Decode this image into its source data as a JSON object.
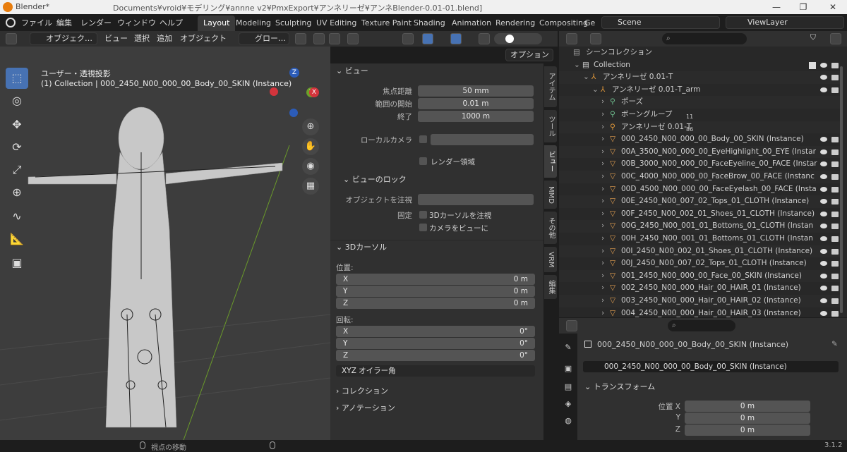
{
  "titlebar": {
    "app": "Blender*",
    "path": "Documents¥vroid¥モデリング¥annne v2¥PmxExport¥アンネリーゼ¥アンネBlender-0.01-01.blend]",
    "minimize": "—",
    "restore": "❐",
    "close": "✕"
  },
  "menu": [
    "ファイル",
    "編集",
    "レンダー",
    "ウィンドウ",
    "ヘルプ"
  ],
  "workspaces": [
    "Layout",
    "Modeling",
    "Sculpting",
    "UV Editing",
    "Texture Paint",
    "Shading",
    "Animation",
    "Rendering",
    "Compositing",
    "Ge"
  ],
  "scene": {
    "label": "Scene",
    "viewlayer": "ViewLayer"
  },
  "viewport_header": {
    "mode": "オブジェク…",
    "view": "ビュー",
    "select": "選択",
    "add": "追加",
    "object": "オブジェクト",
    "orientation": "グロー…",
    "options": "オプション"
  },
  "viewport": {
    "perspective": "ユーザー・透視投影",
    "context": "(1) Collection | 000_2450_N00_000_00_Body_00_SKIN (Instance)",
    "gizmo": {
      "z": "Z",
      "y": "Y",
      "x": "X"
    }
  },
  "npanel": {
    "view_section": "ビュー",
    "focal_label": "焦点距離",
    "focal": "50 mm",
    "clip_start_label": "範囲の開始",
    "clip_start": "0.01 m",
    "clip_end_label": "終了",
    "clip_end": "1000 m",
    "local_camera_label": "ローカルカメラ",
    "render_region": "レンダー領域",
    "view_lock_section": "ビューのロック",
    "lock_object_label": "オブジェクトを注視",
    "lock_label": "固定",
    "lock_cursor": "3Dカーソルを注視",
    "camera_to_view": "カメラをビューに",
    "cursor_section": "3Dカーソル",
    "location_label": "位置:",
    "loc": [
      {
        "axis": "X",
        "value": "0 m"
      },
      {
        "axis": "Y",
        "value": "0 m"
      },
      {
        "axis": "Z",
        "value": "0 m"
      }
    ],
    "rotation_label": "回転:",
    "rot": [
      {
        "axis": "X",
        "value": "0°"
      },
      {
        "axis": "Y",
        "value": "0°"
      },
      {
        "axis": "Z",
        "value": "0°"
      }
    ],
    "rotation_mode": "XYZ オイラー角",
    "collection_section": "コレクション",
    "annotation_section": "アノテーション"
  },
  "ntabs": [
    "アイテム",
    "ツール",
    "ビュー",
    "MMD",
    "その他",
    "VRM",
    "編集"
  ],
  "outliner": {
    "scene_collection": "シーンコレクション",
    "rows": [
      {
        "name": "Collection",
        "indent": 1
      },
      {
        "name": "アンネリーゼ 0.01-T",
        "indent": 2
      },
      {
        "name": "アンネリーゼ 0.01-T_arm",
        "indent": 3
      },
      {
        "name": "ポーズ",
        "indent": 4
      },
      {
        "name": "ボーングループ",
        "indent": 4,
        "badge": "11"
      },
      {
        "name": "アンネリーゼ 0.01-T",
        "indent": 4,
        "badge": "86"
      },
      {
        "name": "000_2450_N00_000_00_Body_00_SKIN (Instance)",
        "indent": 4
      },
      {
        "name": "00A_3500_N00_000_00_EyeHighlight_00_EYE (Instar",
        "indent": 4
      },
      {
        "name": "00B_3000_N00_000_00_FaceEyeline_00_FACE (Instar",
        "indent": 4
      },
      {
        "name": "00C_4000_N00_000_00_FaceBrow_00_FACE (Instanc",
        "indent": 4
      },
      {
        "name": "00D_4500_N00_000_00_FaceEyelash_00_FACE (Insta",
        "indent": 4
      },
      {
        "name": "00E_2450_N00_007_02_Tops_01_CLOTH (Instance)",
        "indent": 4
      },
      {
        "name": "00F_2450_N00_002_01_Shoes_01_CLOTH (Instance)",
        "indent": 4
      },
      {
        "name": "00G_2450_N00_001_01_Bottoms_01_CLOTH (Instan",
        "indent": 4
      },
      {
        "name": "00H_2450_N00_001_01_Bottoms_01_CLOTH (Instan",
        "indent": 4
      },
      {
        "name": "00I_2450_N00_002_01_Shoes_01_CLOTH (Instance)",
        "indent": 4
      },
      {
        "name": "00J_2450_N00_007_02_Tops_01_CLOTH (Instance)",
        "indent": 4
      },
      {
        "name": "001_2450_N00_000_00_Face_00_SKIN (Instance)",
        "indent": 4
      },
      {
        "name": "002_2450_N00_000_Hair_00_HAIR_01 (Instance)",
        "indent": 4
      },
      {
        "name": "003_2450_N00_000_Hair_00_HAIR_02 (Instance)",
        "indent": 4
      },
      {
        "name": "004_2450_N00_000_Hair_00_HAIR_03 (Instance)",
        "indent": 4
      }
    ]
  },
  "properties": {
    "object_name": "000_2450_N00_000_00_Body_00_SKIN (Instance)",
    "data_name": "000_2450_N00_000_00_Body_00_SKIN (Instance)",
    "transform_section": "トランスフォーム",
    "loc": [
      {
        "axis": "位置 X",
        "value": "0 m"
      },
      {
        "axis": "Y",
        "value": "0 m"
      },
      {
        "axis": "Z",
        "value": "0 m"
      }
    ]
  },
  "statusbar": {
    "hint": "視点の移動",
    "version": "3.1.2"
  },
  "colors": {
    "accent": "#4772b3",
    "header": "#303030",
    "viewport": "#3d3d3d",
    "active_tab": "#3a3a3a"
  }
}
